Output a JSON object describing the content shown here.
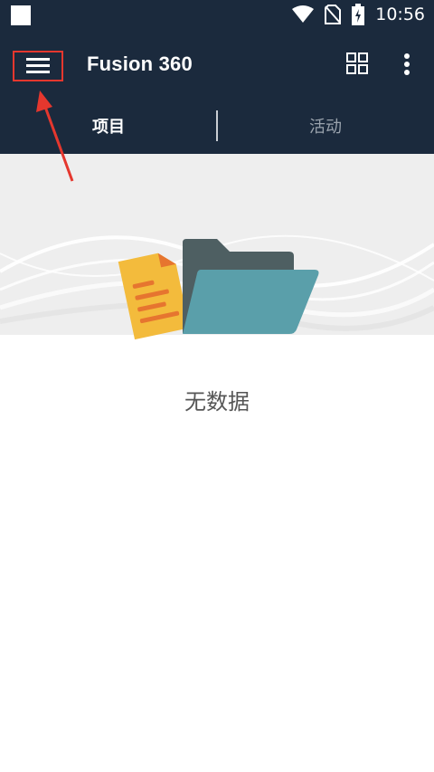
{
  "status_bar": {
    "time": "10:56"
  },
  "app_bar": {
    "title": "Fusion 360"
  },
  "tabs": [
    {
      "label": "项目"
    },
    {
      "label": "活动"
    }
  ],
  "empty_state": {
    "text": "无数据"
  },
  "colors": {
    "app_bar_bg": "#1b2a3d",
    "highlight_border": "#e5372e",
    "folder_front": "#5a9faa",
    "folder_back": "#4e5f62",
    "document": "#f3bb3c",
    "document_lines": "#e6752f"
  },
  "icons": [
    "wifi-icon",
    "no-sim-icon",
    "battery-icon",
    "hamburger-menu-icon",
    "grid-view-icon",
    "more-vert-icon",
    "folder-document-illustration"
  ]
}
